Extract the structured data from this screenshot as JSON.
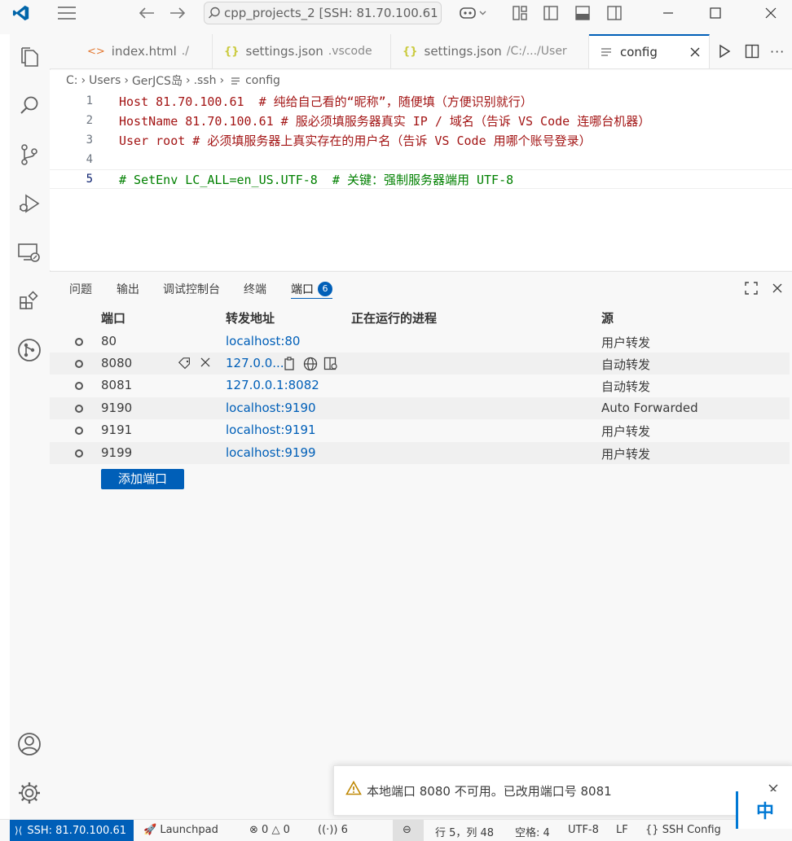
{
  "titlebar": {
    "search_text": "cpp_projects_2 [SSH: 81.70.100.61"
  },
  "tabs": [
    {
      "label": "index.html",
      "desc": "./"
    },
    {
      "label": "settings.json",
      "desc": ".vscode"
    },
    {
      "label": "settings.json",
      "desc": "/C:/.../User"
    },
    {
      "label": "config",
      "desc": ""
    }
  ],
  "breadcrumb": [
    "C:",
    "Users",
    "GerJCS岛",
    ".ssh",
    "config"
  ],
  "editor": {
    "lines": [
      {
        "n": "1",
        "kw": "Host 81.70.100.61",
        "rest": "  # 纯给自己看的“昵称”，随便填（方便识别就行）"
      },
      {
        "n": "2",
        "kw": "HostName 81.70.100.61",
        "rest": " # 服必须填服务器真实 IP / 域名（告诉 VS Code 连哪台机器）"
      },
      {
        "n": "3",
        "kw": "User root",
        "rest": " # 必须填服务器上真实存在的用户名（告诉 VS Code 用哪个账号登录）"
      },
      {
        "n": "4",
        "kw": "",
        "rest": ""
      },
      {
        "n": "5",
        "kw": "",
        "rest": "# SetEnv LC_ALL=en_US.UTF-8  # 关键：强制服务器端用 UTF-8"
      }
    ]
  },
  "panel": {
    "tabs": [
      "问题",
      "输出",
      "调试控制台",
      "终端",
      "端口"
    ],
    "ports_count": "6",
    "columns": [
      "端口",
      "转发地址",
      "正在运行的进程",
      "源"
    ],
    "rows": [
      {
        "port": "80",
        "address": "localhost:80",
        "process": "",
        "origin": "用户转发"
      },
      {
        "port": "8080",
        "address": "127.0.0...",
        "process": "",
        "origin": "自动转发"
      },
      {
        "port": "8081",
        "address": "127.0.0.1:8082",
        "process": "",
        "origin": "自动转发"
      },
      {
        "port": "9190",
        "address": "localhost:9190",
        "process": "",
        "origin": "Auto Forwarded"
      },
      {
        "port": "9191",
        "address": "localhost:9191",
        "process": "",
        "origin": "用户转发"
      },
      {
        "port": "9199",
        "address": "localhost:9199",
        "process": "",
        "origin": "用户转发"
      }
    ],
    "add_port_label": "添加端口"
  },
  "notification": {
    "text": "本地端口 8080 不可用。已改用端口号 8081"
  },
  "statusbar": {
    "remote": "SSH: 81.70.100.61",
    "launchpad": "Launchpad",
    "errors": "0",
    "warnings": "0",
    "ports": "6",
    "position": "行 5，列 48",
    "spaces": "空格: 4",
    "encoding": "UTF-8",
    "eol": "LF",
    "language": "SSH Config"
  },
  "ime": {
    "label": "中"
  },
  "colors": {
    "accent": "#005fb8",
    "keyword": "#a31515",
    "comment": "#008000"
  }
}
